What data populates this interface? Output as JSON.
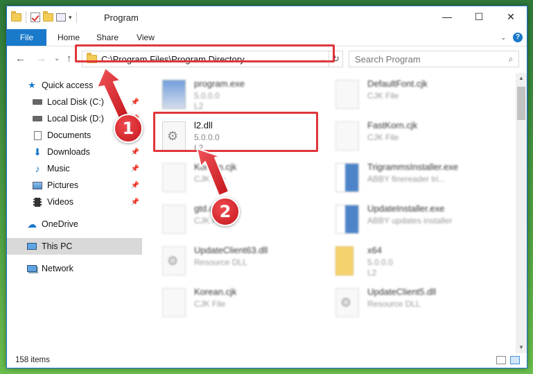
{
  "window": {
    "title": "Program",
    "controls": {
      "minimize": "—",
      "maximize": "☐",
      "close": "✕"
    }
  },
  "ribbon": {
    "tabs": [
      {
        "label": "File",
        "active": true
      },
      {
        "label": "Home"
      },
      {
        "label": "Share"
      },
      {
        "label": "View"
      }
    ],
    "help": "?"
  },
  "address_bar": {
    "path": "C:\\Program Files\\Program Directory",
    "search_placeholder": "Search Program"
  },
  "sidebar": {
    "quick_access": "Quick access",
    "items": [
      {
        "label": "Local Disk (C:)",
        "icon": "drive-icon"
      },
      {
        "label": "Local Disk (D:)",
        "icon": "drive-icon"
      },
      {
        "label": "Documents",
        "icon": "documents-icon"
      },
      {
        "label": "Downloads",
        "icon": "download-icon"
      },
      {
        "label": "Music",
        "icon": "music-icon"
      },
      {
        "label": "Pictures",
        "icon": "pictures-icon"
      },
      {
        "label": "Videos",
        "icon": "videos-icon"
      }
    ],
    "onedrive": "OneDrive",
    "this_pc": "This PC",
    "network": "Network"
  },
  "files": [
    {
      "name": "program.exe",
      "line1": "5.0.0.0",
      "line2": "L2",
      "icon": "exe"
    },
    {
      "name": "DefaultFont.cjk",
      "line1": "CJK File",
      "line2": "",
      "icon": "doc"
    },
    {
      "name": "l2.dll",
      "line1": "5.0.0.0",
      "line2": "L2",
      "icon": "dll"
    },
    {
      "name": "FastKorn.cjk",
      "line1": "CJK File",
      "line2": "",
      "icon": "doc"
    },
    {
      "name": "Korean.cjk",
      "line1": "CJK File",
      "line2": "",
      "icon": "doc"
    },
    {
      "name": "TrigrammsInstaller.exe",
      "line1": "ABBY finereader tri...",
      "line2": "",
      "icon": "app"
    },
    {
      "name": "gtd.cjk",
      "line1": "CJK File",
      "line2": "",
      "icon": "doc"
    },
    {
      "name": "UpdateInstaller.exe",
      "line1": "ABBY updates installer",
      "line2": "",
      "icon": "app"
    },
    {
      "name": "UpdateClient63.dll",
      "line1": "Resource DLL",
      "line2": "",
      "icon": "dll"
    },
    {
      "name": "x64",
      "line1": "5.0.0.0",
      "line2": "L2",
      "icon": "folder"
    },
    {
      "name": "Korean.cjk",
      "line1": "CJK File",
      "line2": "",
      "icon": "doc"
    },
    {
      "name": "UpdateClient5.dll",
      "line1": "Resource DLL",
      "line2": "",
      "icon": "dll"
    }
  ],
  "status": {
    "item_count": "158 items"
  },
  "annotations": {
    "step1": "1",
    "step2": "2"
  },
  "colors": {
    "accent": "#1979ca",
    "highlight": "#e0353b"
  }
}
